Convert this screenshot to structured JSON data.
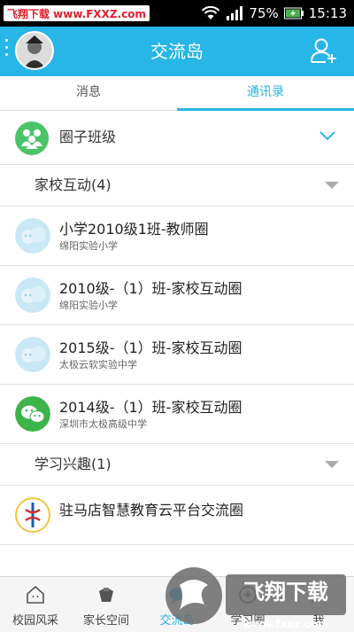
{
  "status_bar": {
    "watermark_text": "飞翔下载 www.FXXZ.com",
    "battery_percent": "75%",
    "time": "15:13"
  },
  "header": {
    "title": "交流岛",
    "add_icon": "add-user-icon",
    "accent_color": "#28b5e7"
  },
  "tabs": [
    {
      "label": "消息",
      "active": false
    },
    {
      "label": "通讯录",
      "active": true
    }
  ],
  "group": {
    "title": "圈子班级",
    "icon": "circle-group-icon"
  },
  "categories": [
    {
      "label": "家校互动(4)",
      "items": [
        {
          "title": "小学2010级1班-教师圈",
          "subtitle": "绵阳实验小学",
          "icon": "class-chat-icon"
        },
        {
          "title": "2010级-（1）班-家校互动圈",
          "subtitle": "绵阳实验小学",
          "icon": "class-chat-icon"
        },
        {
          "title": "2015级-（1）班-家校互动圈",
          "subtitle": "太极云软实验中学",
          "icon": "class-chat-icon"
        },
        {
          "title": "2014级-（1）班-家校互动圈",
          "subtitle": "深圳市太极高级中学",
          "icon": "wechat-icon"
        }
      ]
    },
    {
      "label": "学习兴趣(1)",
      "items": [
        {
          "title": "驻马店智慧教育云平台交流圈",
          "subtitle": "",
          "icon": "school-emblem-icon"
        }
      ]
    }
  ],
  "bottom_nav": [
    {
      "label": "校园风采",
      "icon": "home-icon",
      "active": false
    },
    {
      "label": "家长空间",
      "icon": "parent-icon",
      "active": false
    },
    {
      "label": "交流岛",
      "icon": "chat-island-icon",
      "active": true
    },
    {
      "label": "学习圈",
      "icon": "study-icon",
      "active": false
    },
    {
      "label": "我",
      "icon": "profile-icon",
      "active": false
    }
  ],
  "overlay_watermark": {
    "title": "飞翔下载",
    "url": "www.fxxz.com"
  }
}
